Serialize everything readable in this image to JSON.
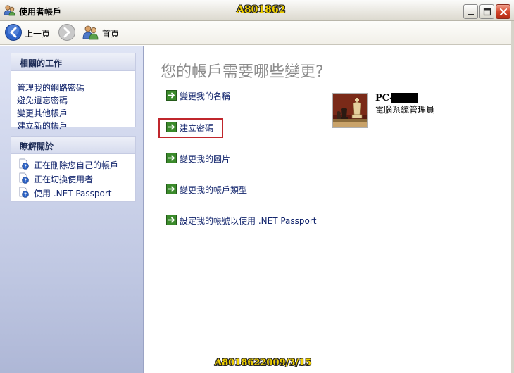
{
  "window": {
    "title": "使用者帳戶",
    "watermark_top": "A801862",
    "watermark_bottom": "A8018622009/3/15"
  },
  "toolbar": {
    "back_label": "上一頁",
    "home_label": "首頁"
  },
  "sidebar": {
    "related_tasks": {
      "title": "相關的工作",
      "items": [
        "管理我的網路密碼",
        "避免遺忘密碼",
        "變更其他帳戶",
        "建立新的帳戶"
      ]
    },
    "learn_about": {
      "title": "瞭解關於",
      "items": [
        "正在刪除您自己的帳戶",
        "正在切換使用者",
        "使用 .NET Passport"
      ]
    }
  },
  "main": {
    "heading": "您的帳戶需要哪些變更?",
    "actions": [
      "變更我的名稱",
      "建立密碼",
      "變更我的圖片",
      "變更我的帳戶類型",
      "設定我的帳號以使用 .NET Passport"
    ],
    "highlighted_action_index": 1,
    "user": {
      "name": "PC-",
      "role": "電腦系統管理員"
    }
  },
  "colors": {
    "link": "#10236b",
    "highlight_box": "#c0262c",
    "arrow_icon": "#3a8a2a",
    "watermark": "#f0d000"
  }
}
